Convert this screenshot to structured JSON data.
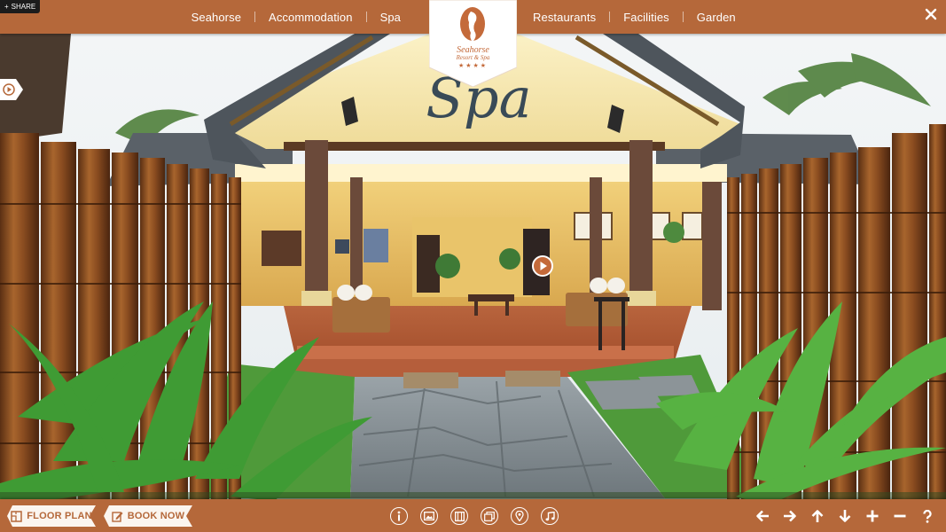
{
  "nav": {
    "left": [
      "Seahorse",
      "Accommodation",
      "Spa"
    ],
    "right": [
      "Restaurants",
      "Facilities",
      "Garden"
    ]
  },
  "share": {
    "label": "SHARE"
  },
  "logo": {
    "line1": "Seahorse",
    "line2": "Resort & Spa",
    "stars": "★★★★"
  },
  "scene": {
    "sign_text": "Spa"
  },
  "bottom": {
    "floor_plan": "FLOOR PLAN",
    "book_now": "BOOK NOW"
  },
  "icons": {
    "middle": [
      "info-icon",
      "photo-icon",
      "map-icon",
      "thumbs-icon",
      "location-icon",
      "music-icon"
    ],
    "controls": [
      "arrow-left-icon",
      "arrow-right-icon",
      "arrow-up-icon",
      "arrow-down-icon",
      "zoom-in-icon",
      "zoom-out-icon",
      "help-icon"
    ]
  },
  "colors": {
    "bar": "#b5683a",
    "accent": "#c46a3a"
  }
}
